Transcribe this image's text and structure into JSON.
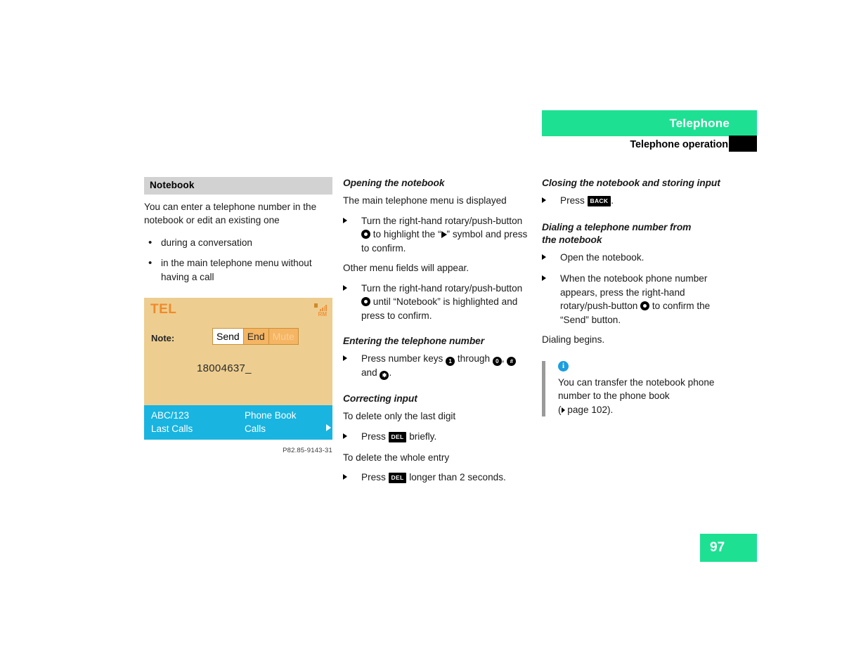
{
  "header": {
    "chapter_title": "Telephone",
    "section_title": "Telephone operation",
    "green": "#1ee093"
  },
  "page_number": "97",
  "column_left": {
    "section_bar": "Notebook",
    "intro": "You can enter a telephone number in the notebook or edit an existing one",
    "bullets": [
      "during a conversation",
      "in the main telephone menu without having a call"
    ],
    "screen": {
      "mode_label": "TEL",
      "roaming_label": "RM",
      "note_label": "Note:",
      "softkeys": [
        {
          "label": "Send",
          "state": "selected"
        },
        {
          "label": "End",
          "state": "normal"
        },
        {
          "label": "Mute",
          "state": "dimmed"
        }
      ],
      "number_entry": "18004637_",
      "menu_top_left": "ABC/123",
      "menu_bottom_left": "Last Calls",
      "menu_top_right": "Phone Book",
      "menu_bottom_right": "Calls"
    },
    "caption": "P82.85-9143-31"
  },
  "column_middle": {
    "heading_open": "Opening the notebook",
    "open_intro": "The main telephone menu is displayed",
    "step_1_a": "Turn the right-hand rotary/push-button",
    "step_1_b_pre": "to highlight the “",
    "step_1_b_post": "” symbol and press to confirm.",
    "step_1_result": "Other menu fields will appear.",
    "step_2_a": "Turn the right-hand rotary/push-button",
    "step_2_b_pre": "until “Notebook” is highlighted and press to confirm.",
    "heading_entering": "Entering the telephone number",
    "entering_pre": "Press number keys",
    "entering_mid": "through",
    "entering_and": "and",
    "key_1": "1",
    "key_0": "0",
    "key_hash": "#",
    "key_star": "✱",
    "heading_correcting": "Correcting input",
    "correct_intro_1": "To delete only the last digit",
    "correct_step_1_pre": "Press",
    "correct_step_1_post": "briefly.",
    "correct_intro_2": "To delete the whole entry",
    "correct_step_2_pre": "Press",
    "correct_step_2_post": "longer than 2 seconds.",
    "key_del": "DEL"
  },
  "column_right": {
    "heading_closing": "Closing the notebook and storing input",
    "closing_step_pre": "Press",
    "closing_step_post": ".",
    "key_back": "BACK",
    "heading_dialing_line1": "Dialing a telephone number from",
    "heading_dialing_line2": "the notebook",
    "dial_step_1": "Open the notebook.",
    "dial_step_2_a": "When the notebook phone number appears, press the right-hand rotary/push-button",
    "dial_step_2_b": "to confirm the “Send” button.",
    "dial_result": "Dialing begins.",
    "note": {
      "icon": "info-icon",
      "text_line_1": "You can transfer the notebook phone",
      "text_line_2": "number to the phone book",
      "reference_pre": "(",
      "reference_post": " page 102)."
    }
  },
  "colors": {
    "accent_green": "#1ee093",
    "info_blue": "#1a9fe0",
    "screen_bg": "#edce90",
    "screen_menu_blue": "#19b4e0",
    "softkey_orange": "#f5b562"
  }
}
